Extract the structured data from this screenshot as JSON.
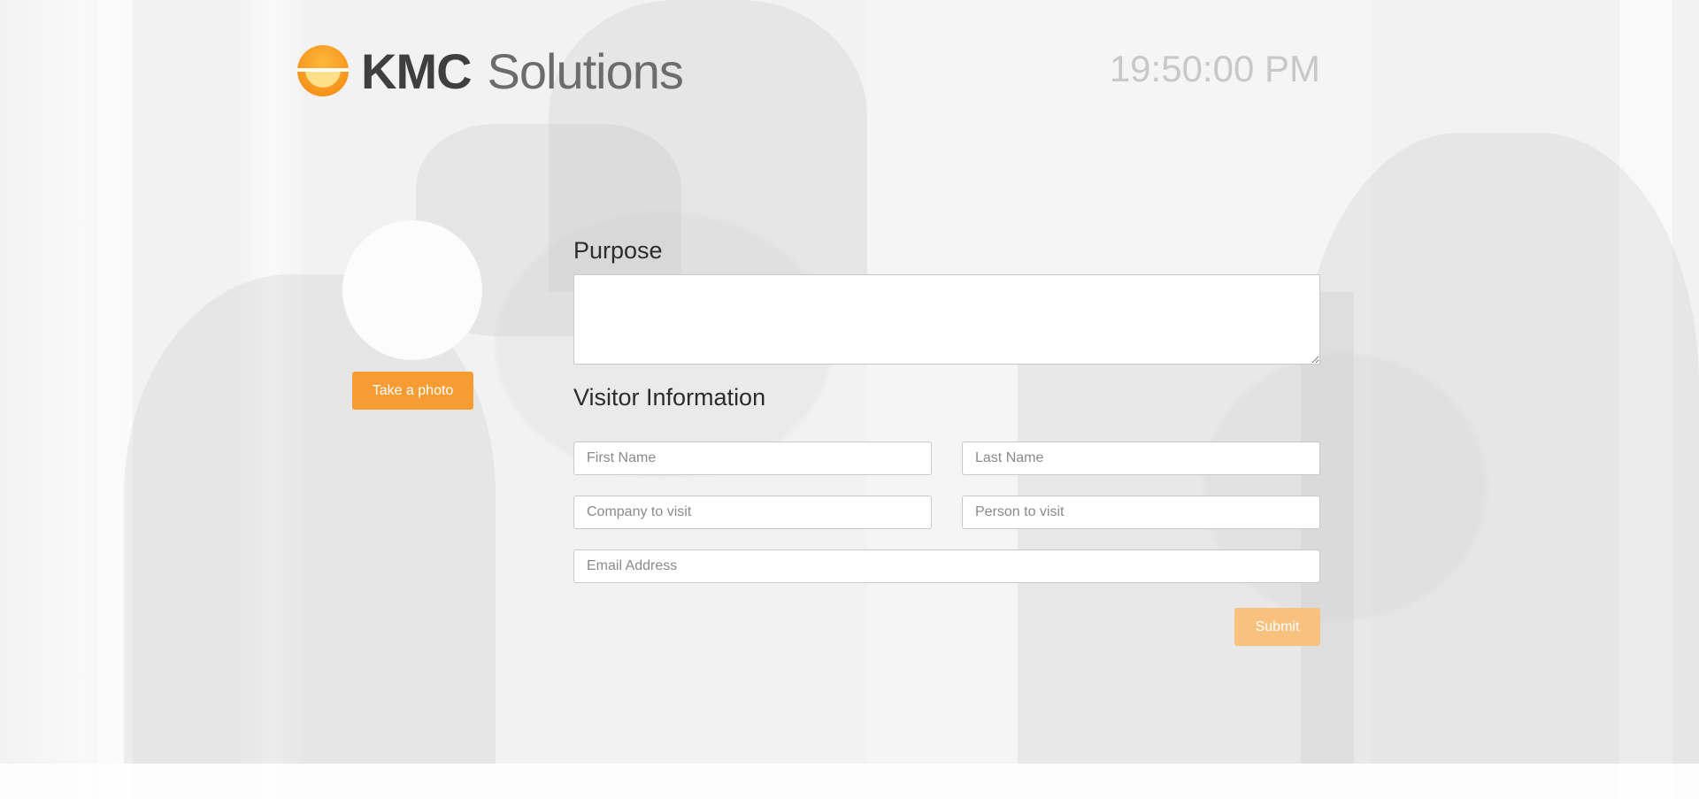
{
  "header": {
    "brand_strong": "KMC",
    "brand_light": "Solutions",
    "clock": "19:50:00 PM"
  },
  "photo": {
    "button_label": "Take a photo"
  },
  "form": {
    "purpose_heading": "Purpose",
    "visitor_heading": "Visitor Information",
    "first_name_placeholder": "First Name",
    "last_name_placeholder": "Last Name",
    "company_placeholder": "Company to visit",
    "person_placeholder": "Person to visit",
    "email_placeholder": "Email Address",
    "submit_label": "Submit"
  },
  "colors": {
    "accent": "#f69c33",
    "accent_disabled": "#f8c17e",
    "clock": "#c8c8c8"
  }
}
